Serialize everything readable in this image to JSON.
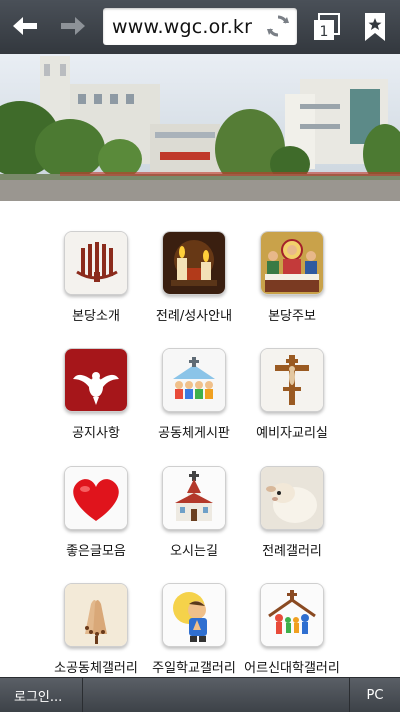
{
  "browser": {
    "url": "www.wgc.or.kr",
    "tab_count": "1",
    "icons": [
      "back-arrow-icon",
      "forward-arrow-icon",
      "refresh-icon",
      "tabs-icon",
      "bookmark-icon"
    ]
  },
  "menu": {
    "items": [
      {
        "label": "본당소개",
        "icon": "church-organ-icon"
      },
      {
        "label": "전례/성사안내",
        "icon": "candles-icon"
      },
      {
        "label": "본당주보",
        "icon": "last-supper-icon"
      },
      {
        "label": "공지사항",
        "icon": "holy-spirit-dove-icon"
      },
      {
        "label": "공동체게시판",
        "icon": "community-icon"
      },
      {
        "label": "예비자교리실",
        "icon": "crucifix-icon"
      },
      {
        "label": "좋은글모음",
        "icon": "heart-icon"
      },
      {
        "label": "오시는길",
        "icon": "chapel-icon"
      },
      {
        "label": "전례갤러리",
        "icon": "lamb-icon"
      },
      {
        "label": "소공동체갤러리",
        "icon": "praying-hands-icon"
      },
      {
        "label": "주일학교갤러리",
        "icon": "praying-child-icon"
      },
      {
        "label": "어르신대학갤러리",
        "icon": "family-church-icon"
      }
    ]
  },
  "footer": {
    "login_label": "로그인...",
    "pc_label": "PC"
  },
  "colors": {
    "toolbar": "#3d4248",
    "heart": "#e0141c",
    "dove_bg": "#a6161a"
  }
}
